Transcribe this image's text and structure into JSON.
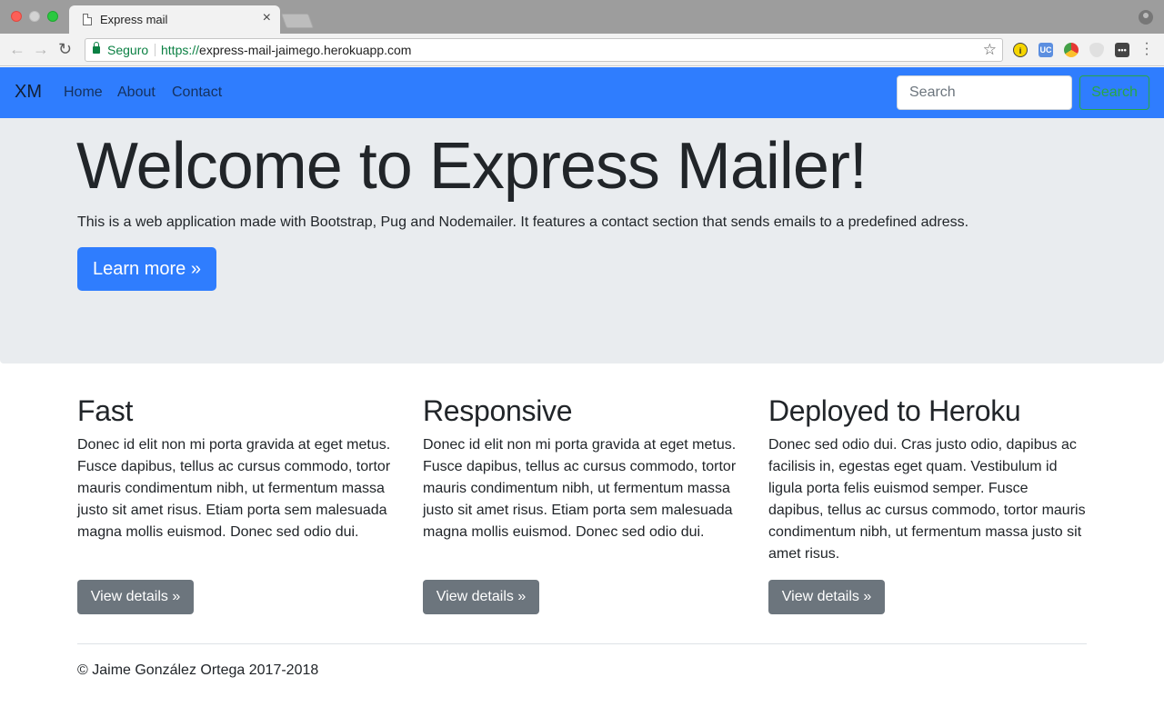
{
  "browser": {
    "tab_title": "Express mail",
    "tab_close": "×",
    "secure_label": "Seguro",
    "url_scheme": "https://",
    "url_host": "express-mail-jaimego.herokuapp.com",
    "ext_2_label": "UC",
    "ext_1_label": "i"
  },
  "navbar": {
    "brand": "XM",
    "links": [
      "Home",
      "About",
      "Contact"
    ],
    "search_placeholder": "Search",
    "search_button": "Search",
    "bg_color": "#2f7dfe"
  },
  "jumbotron": {
    "title": "Welcome to Express Mailer!",
    "lead": "This is a web application made with Bootstrap, Pug and Nodemailer. It features a contact section that sends emails to a predefined adress.",
    "button": "Learn more »"
  },
  "features": [
    {
      "title": "Fast",
      "text": "Donec id elit non mi porta gravida at eget metus. Fusce dapibus, tellus ac cursus commodo, tortor mauris condimentum nibh, ut fermentum massa justo sit amet risus. Etiam porta sem malesuada magna mollis euismod. Donec sed odio dui.",
      "button": "View details »"
    },
    {
      "title": "Responsive",
      "text": "Donec id elit non mi porta gravida at eget metus. Fusce dapibus, tellus ac cursus commodo, tortor mauris condimentum nibh, ut fermentum massa justo sit amet risus. Etiam porta sem malesuada magna mollis euismod. Donec sed odio dui.",
      "button": "View details »"
    },
    {
      "title": "Deployed to Heroku",
      "text": "Donec sed odio dui. Cras justo odio, dapibus ac facilisis in, egestas eget quam. Vestibulum id ligula porta felis euismod semper. Fusce dapibus, tellus ac cursus commodo, tortor mauris condimentum nibh, ut fermentum massa justo sit amet risus.",
      "button": "View details »"
    }
  ],
  "footer": {
    "text": "© Jaime González Ortega 2017-2018"
  }
}
